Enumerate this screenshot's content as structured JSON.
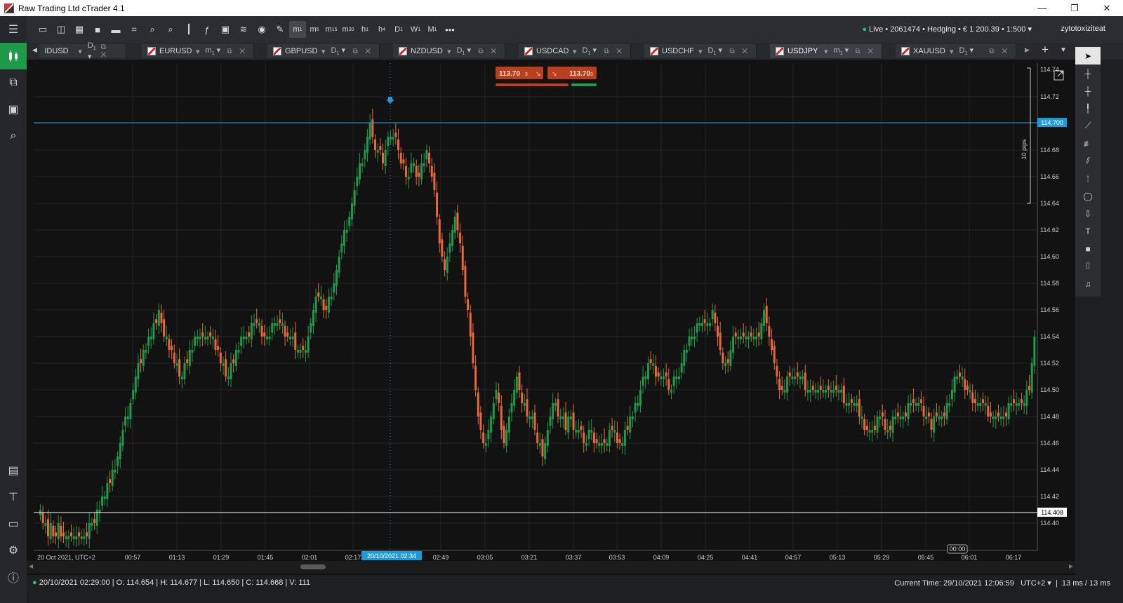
{
  "window": {
    "title": "Raw Trading Ltd cTrader 4.1",
    "min": "—",
    "max": "❐",
    "close": "✕"
  },
  "toolbar": {
    "timeframes": [
      {
        "l": "m",
        "s": "1",
        "sel": true
      },
      {
        "l": "m",
        "s": "5"
      },
      {
        "l": "m",
        "s": "15"
      },
      {
        "l": "m",
        "s": "30"
      },
      {
        "l": "h",
        "s": "1"
      },
      {
        "l": "h",
        "s": "4"
      },
      {
        "l": "D",
        "s": "1"
      },
      {
        "l": "W",
        "s": "1"
      },
      {
        "l": "M",
        "s": "1"
      }
    ],
    "more": "•••",
    "account": "Live • 2061474 • Hedging • € 1 200.39 • 1:500",
    "account_caret": "▾",
    "user": "zytotoxiziteat"
  },
  "tabs": [
    {
      "symbol": "IDUSD",
      "tf": "D",
      "tfs": "1",
      "partial": true
    },
    {
      "symbol": "EURUSD",
      "tf": "m",
      "tfs": "1"
    },
    {
      "symbol": "GBPUSD",
      "tf": "D",
      "tfs": "1"
    },
    {
      "symbol": "NZDUSD",
      "tf": "D",
      "tfs": "1"
    },
    {
      "symbol": "USDCAD",
      "tf": "D",
      "tfs": "1"
    },
    {
      "symbol": "USDCHF",
      "tf": "D",
      "tfs": "1"
    },
    {
      "symbol": "USDJPY",
      "tf": "m",
      "tfs": "1",
      "active": true
    },
    {
      "symbol": "XAUUSD",
      "tf": "D",
      "tfs": "1"
    }
  ],
  "trade": {
    "sell_price": "113.70",
    "sell_suffix": "3",
    "buy_price": "113.70",
    "buy_suffix": "3"
  },
  "price_axis": {
    "ticks": [
      "114.72",
      "114.70",
      "114.68",
      "114.66",
      "114.64",
      "114.62",
      "114.60",
      "114.58",
      "114.56",
      "114.54",
      "114.52",
      "114.50",
      "114.48",
      "114.46",
      "114.44",
      "114.42",
      "114.40"
    ],
    "top_partial": "114.74",
    "hline_blue": "114.700",
    "hline_white": "114.408",
    "pips_label": "10 pips"
  },
  "time_axis": {
    "start_label": "20 Oct 2021, UTC+2",
    "labels": [
      "00:57",
      "01:13",
      "01:29",
      "01:45",
      "02:01",
      "02:17",
      "02:49",
      "03:05",
      "03:21",
      "03:37",
      "03:53",
      "04:09",
      "04:25",
      "04:41",
      "04:57",
      "05:13",
      "05:29",
      "05:45",
      "06:01",
      "06:17"
    ],
    "crosshair_label": "20/10/2021 02:34",
    "countdown": "00:00"
  },
  "status": {
    "bar_info": "20/10/2021 02:29:00 | O: 114.654 | H: 114.677 | L: 114.650 | C: 114.668 | V: 111",
    "current_time_label": "Current Time:",
    "current_time": "29/10/2021 12:06:59",
    "tz": "UTC+2",
    "latency": "13 ms / 13 ms"
  },
  "colors": {
    "up": "#1f9a4a",
    "down": "#e8683a",
    "blue_line": "#1e9bd7",
    "grid": "#242424",
    "bg": "#121212"
  },
  "chart_data": {
    "type": "candlestick",
    "symbol": "USDJPY",
    "timeframe": "m1",
    "ylim": [
      114.39,
      114.74
    ],
    "closes": [
      114.41,
      114.4,
      114.4,
      114.39,
      114.4,
      114.39,
      114.39,
      114.4,
      114.39,
      114.39,
      114.39,
      114.39,
      114.39,
      114.39,
      114.39,
      114.39,
      114.39,
      114.39,
      114.39,
      114.4,
      114.4,
      114.4,
      114.41,
      114.41,
      114.42,
      114.42,
      114.43,
      114.43,
      114.44,
      114.44,
      114.45,
      114.46,
      114.47,
      114.48,
      114.48,
      114.49,
      114.5,
      114.51,
      114.52,
      114.52,
      114.53,
      114.53,
      114.54,
      114.54,
      114.55,
      114.55,
      114.56,
      114.55,
      114.54,
      114.54,
      114.53,
      114.53,
      114.52,
      114.52,
      114.51,
      114.51,
      114.52,
      114.52,
      114.53,
      114.53,
      114.54,
      114.54,
      114.54,
      114.54,
      114.54,
      114.54,
      114.54,
      114.54,
      114.53,
      114.53,
      114.52,
      114.52,
      114.51,
      114.51,
      114.52,
      114.52,
      114.53,
      114.53,
      114.54,
      114.54,
      114.54,
      114.54,
      114.55,
      114.55,
      114.55,
      114.55,
      114.54,
      114.54,
      114.54,
      114.54,
      114.55,
      114.55,
      114.55,
      114.55,
      114.55,
      114.54,
      114.54,
      114.54,
      114.54,
      114.53,
      114.53,
      114.53,
      114.53,
      114.53,
      114.54,
      114.55,
      114.56,
      114.57,
      114.57,
      114.57,
      114.56,
      114.56,
      114.57,
      114.57,
      114.58,
      114.59,
      114.6,
      114.61,
      114.62,
      114.62,
      114.63,
      114.64,
      114.65,
      114.66,
      114.67,
      114.67,
      114.68,
      114.69,
      114.7,
      114.69,
      114.68,
      114.68,
      114.68,
      114.67,
      114.68,
      114.69,
      114.69,
      114.69,
      114.69,
      114.68,
      114.67,
      114.67,
      114.66,
      114.66,
      114.67,
      114.67,
      114.66,
      114.66,
      114.67,
      114.67,
      114.68,
      114.67,
      114.66,
      114.65,
      114.63,
      114.61,
      114.6,
      114.59,
      114.6,
      114.61,
      114.62,
      114.63,
      114.62,
      114.61,
      114.59,
      114.57,
      114.56,
      114.54,
      114.52,
      114.5,
      114.48,
      114.47,
      114.46,
      114.46,
      114.47,
      114.48,
      114.49,
      114.5,
      114.49,
      114.47,
      114.46,
      114.47,
      114.48,
      114.49,
      114.5,
      114.51,
      114.5,
      114.49,
      114.49,
      114.48,
      114.48,
      114.48,
      114.47,
      114.46,
      114.46,
      114.45,
      114.46,
      114.47,
      114.48,
      114.49,
      114.49,
      114.48,
      114.48,
      114.48,
      114.47,
      114.48,
      114.48,
      114.47,
      114.47,
      114.47,
      114.47,
      114.46,
      114.46,
      114.47,
      114.47,
      114.46,
      114.46,
      114.46,
      114.46,
      114.46,
      114.46,
      114.47,
      114.47,
      114.47,
      114.46,
      114.46,
      114.46,
      114.47,
      114.47,
      114.48,
      114.48,
      114.49,
      114.49,
      114.5,
      114.51,
      114.51,
      114.52,
      114.52,
      114.52,
      114.51,
      114.51,
      114.51,
      114.51,
      114.51,
      114.5,
      114.5,
      114.51,
      114.51,
      114.51,
      114.52,
      114.53,
      114.53,
      114.54,
      114.54,
      114.54,
      114.55,
      114.55,
      114.55,
      114.55,
      114.55,
      114.55,
      114.56,
      114.55,
      114.54,
      114.53,
      114.52,
      114.52,
      114.52,
      114.53,
      114.54,
      114.54,
      114.54,
      114.54,
      114.54,
      114.54,
      114.54,
      114.54,
      114.54,
      114.54,
      114.54,
      114.55,
      114.56,
      114.55,
      114.54,
      114.53,
      114.52,
      114.51,
      114.5,
      114.5,
      114.5,
      114.51,
      114.51,
      114.51,
      114.51,
      114.51,
      114.51,
      114.51,
      114.5,
      114.5,
      114.5,
      114.5,
      114.5,
      114.5,
      114.5,
      114.5,
      114.5,
      114.5,
      114.5,
      114.5,
      114.5,
      114.5,
      114.5,
      114.49,
      114.49,
      114.49,
      114.49,
      114.49,
      114.49,
      114.48,
      114.48,
      114.47,
      114.47,
      114.47,
      114.47,
      114.47,
      114.48,
      114.48,
      114.48,
      114.47,
      114.47,
      114.47,
      114.48,
      114.48,
      114.48,
      114.48,
      114.48,
      114.48,
      114.49,
      114.49,
      114.49,
      114.49,
      114.49,
      114.49,
      114.48,
      114.48,
      114.48,
      114.47,
      114.48,
      114.48,
      114.48,
      114.48,
      114.48,
      114.49,
      114.49,
      114.5,
      114.51,
      114.51,
      114.51,
      114.51,
      114.5,
      114.5,
      114.5,
      114.49,
      114.49,
      114.49,
      114.49,
      114.49,
      114.49,
      114.48,
      114.48,
      114.48,
      114.48,
      114.48,
      114.48,
      114.48,
      114.48,
      114.49,
      114.49,
      114.49,
      114.49,
      114.49,
      114.49,
      114.49,
      114.5,
      114.5,
      114.52,
      114.54
    ]
  }
}
